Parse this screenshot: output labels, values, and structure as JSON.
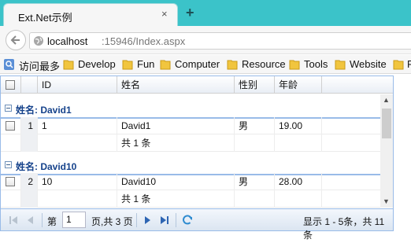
{
  "browser": {
    "tab_title": "Ext.Net示例",
    "tab_close": "×",
    "new_tab": "+",
    "url_host": "localhost",
    "url_rest": ":15946/Index.aspx",
    "bookmarks": [
      "访问最多",
      "Develop",
      "Fun",
      "Computer",
      "Resource",
      "Tools",
      "Website",
      "F"
    ]
  },
  "grid": {
    "columns": [
      "ID",
      "姓名",
      "性别",
      "年龄"
    ],
    "groups": [
      {
        "title": "姓名: David1",
        "rows": [
          {
            "rownum": "1",
            "id": "1",
            "name": "David1",
            "gender": "男",
            "age": "19.00"
          }
        ],
        "summary": "共 1 条"
      },
      {
        "title": "姓名: David10",
        "rows": [
          {
            "rownum": "2",
            "id": "10",
            "name": "David10",
            "gender": "男",
            "age": "28.00"
          }
        ],
        "summary": "共 1 条"
      }
    ]
  },
  "pager": {
    "page_label": "第",
    "page_value": "1",
    "page_total": "页,共 3 页",
    "display_info": "显示 1 - 5条，共 11 条"
  }
}
